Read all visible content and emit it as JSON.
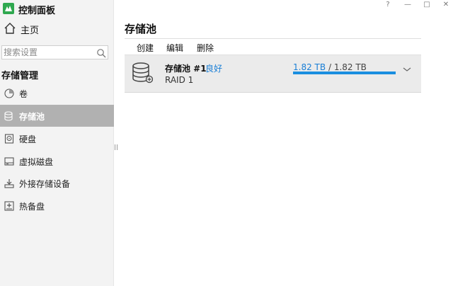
{
  "app": {
    "title": "控制面板"
  },
  "window_controls": {
    "help": "?",
    "minimize": "—",
    "maximize": "□",
    "close": "✕"
  },
  "sidebar": {
    "home_label": "主页",
    "search_placeholder": "搜索设置",
    "section_title": "存储管理",
    "items": [
      {
        "label": "卷",
        "icon": "volume-icon"
      },
      {
        "label": "存储池",
        "icon": "storage-pool-icon",
        "active": true
      },
      {
        "label": "硬盘",
        "icon": "hard-disk-icon"
      },
      {
        "label": "虚拟磁盘",
        "icon": "virtual-disk-icon"
      },
      {
        "label": "外接存储设备",
        "icon": "external-storage-icon"
      },
      {
        "label": "热备盘",
        "icon": "hot-spare-icon"
      }
    ]
  },
  "main": {
    "title": "存储池",
    "toolbar": {
      "create": "创建",
      "edit": "编辑",
      "delete": "删除"
    },
    "pool": {
      "name": "存储池 #1",
      "status": "良好",
      "raid": "RAID 1",
      "used": "1.82 TB",
      "separator": "/",
      "total": "1.82 TB",
      "usage_fraction": 1.0
    }
  },
  "colors": {
    "accent": "#1a7fd6",
    "progress": "#1a8ee0",
    "active_bg": "#b1b1b1",
    "brand": "#2fa84f"
  }
}
